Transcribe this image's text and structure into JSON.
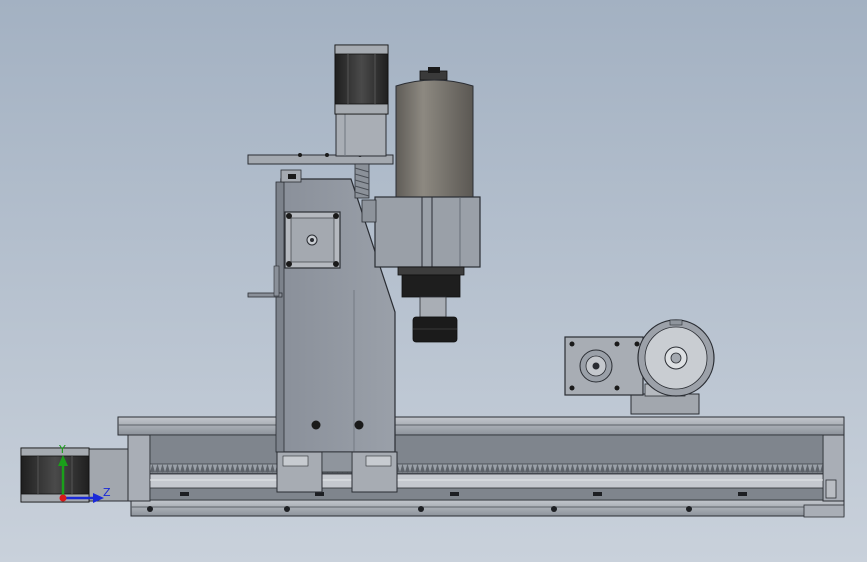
{
  "view": {
    "triad": {
      "y_label": "Y",
      "z_label": "Z",
      "y_color": "#1aa01a",
      "z_color": "#1a2ad8",
      "x_color": "#d81a1a"
    }
  },
  "colors": {
    "metal": "#9096a0",
    "metal_dark": "#6f757f",
    "outline": "#2a2d33",
    "spindle_body": "#7a7670",
    "motor_dark": "#2b2b2b"
  }
}
